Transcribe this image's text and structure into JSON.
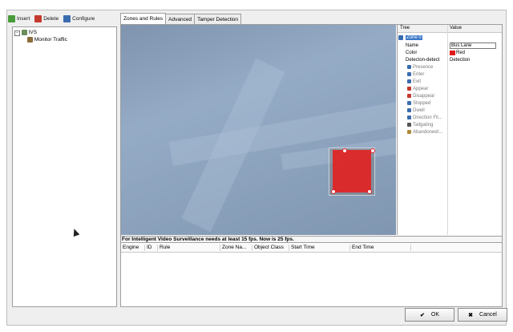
{
  "toolbar": {
    "insert_label": "Insert",
    "delete_label": "Delete",
    "configure_label": "Configure"
  },
  "tree": {
    "root_label": "IVS",
    "child_label": "Monitor Traffic"
  },
  "tabs": [
    "Zones and Rules",
    "Advanced",
    "Tamper Detection"
  ],
  "properties": {
    "header_tree": "Tree",
    "header_value": "Value",
    "zone_label": "Zone 0",
    "rows": [
      {
        "key": "Name",
        "value": "Bus Lane"
      },
      {
        "key": "Color",
        "value": "Red"
      },
      {
        "key": "Detecton-detect",
        "value": "Detection"
      },
      {
        "key": "Presence",
        "value": ""
      },
      {
        "key": "Enter",
        "value": ""
      },
      {
        "key": "Exit",
        "value": ""
      },
      {
        "key": "Appear",
        "value": ""
      },
      {
        "key": "Disappear",
        "value": ""
      },
      {
        "key": "Stopped",
        "value": ""
      },
      {
        "key": "Dwell",
        "value": ""
      },
      {
        "key": "Direction Fil...",
        "value": ""
      },
      {
        "key": "Tailgating",
        "value": ""
      },
      {
        "key": "Abandoned/...",
        "value": ""
      }
    ],
    "color_swatch": "#e01b1b"
  },
  "status_text": "For Intelligent Video Surveillance needs at least 15 fps. Now is 25 fps.",
  "table": {
    "headers": [
      "Engine",
      "ID",
      "Rule",
      "Zone Na...",
      "Object Class",
      "Start Time",
      "End Time"
    ]
  },
  "buttons": {
    "ok_label": "OK",
    "cancel_label": "Cancel"
  },
  "colors": {
    "zone_fill": "#e32020",
    "video_tint": "#96b4d7"
  }
}
